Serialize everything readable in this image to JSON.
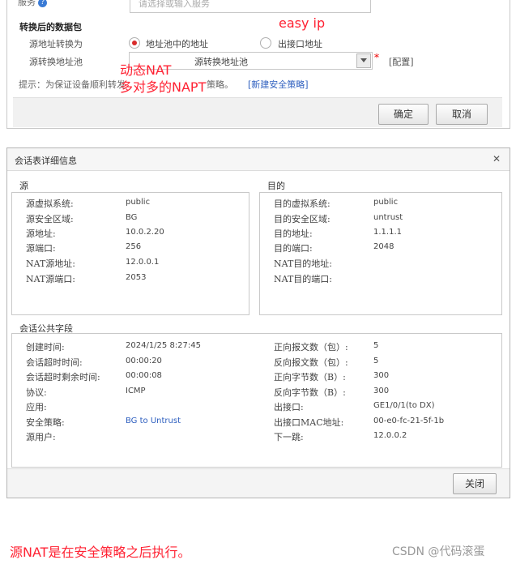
{
  "top_dialog": {
    "service_label": "服务",
    "service_placeholder": "请选择或输入服务",
    "section_title": "转换后的数据包",
    "src_translate_label": "源地址转换为",
    "radio_pool_label": "地址池中的地址",
    "radio_iface_label": "出接口地址",
    "pool_label": "源转换地址池",
    "pool_select_value": "源转换地址池",
    "pool_required_mark": "*",
    "pool_config_link": "[配置]",
    "tip_text": "提示：为保证设备顺利转发",
    "tip_text_end": "策略。",
    "tip_link": "[新建安全策略]",
    "ok_button": "确定",
    "cancel_button": "取消",
    "selected_option": "地址池中的地址"
  },
  "annotations": {
    "easy_ip": "easy ip",
    "nat_line1": "动态NAT",
    "nat_line2": "多对多的NAPT",
    "bottom_note": "源NAT是在安全策略之后执行。",
    "color": "#ff2233"
  },
  "session_dialog": {
    "title": "会话表详细信息",
    "close_button": "关闭",
    "source": {
      "heading": "源",
      "rows": [
        {
          "label": "源虚拟系统:",
          "value": "public"
        },
        {
          "label": "源安全区域:",
          "value": "BG"
        },
        {
          "label": "源地址:",
          "value": "10.0.2.20"
        },
        {
          "label": "源端口:",
          "value": "256"
        },
        {
          "label": "NAT源地址:",
          "value": "12.0.0.1"
        },
        {
          "label": "NAT源端口:",
          "value": "2053"
        }
      ]
    },
    "dest": {
      "heading": "目的",
      "rows": [
        {
          "label": "目的虚拟系统:",
          "value": "public"
        },
        {
          "label": "目的安全区域:",
          "value": "untrust"
        },
        {
          "label": "目的地址:",
          "value": "1.1.1.1"
        },
        {
          "label": "目的端口:",
          "value": "2048"
        },
        {
          "label": "NAT目的地址:",
          "value": ""
        },
        {
          "label": "NAT目的端口:",
          "value": ""
        }
      ]
    },
    "common": {
      "heading": "会话公共字段",
      "left_rows": [
        {
          "label": "创建时间:",
          "value": "2024/1/25 8:27:45"
        },
        {
          "label": "会话超时时间:",
          "value": "00:00:20"
        },
        {
          "label": "会话超时剩余时间:",
          "value": "00:00:08"
        },
        {
          "label": "协议:",
          "value": "ICMP"
        },
        {
          "label": "应用:",
          "value": ""
        },
        {
          "label": "安全策略:",
          "value": "BG  to Untrust"
        },
        {
          "label": "源用户:",
          "value": ""
        }
      ],
      "right_rows": [
        {
          "label": "正向报文数（包）:",
          "value": "5"
        },
        {
          "label": "反向报文数（包）:",
          "value": "5"
        },
        {
          "label": "正向字节数（B）:",
          "value": "300"
        },
        {
          "label": "反向字节数（B）:",
          "value": "300"
        },
        {
          "label": "出接口:",
          "value": "GE1/0/1(to DX)"
        },
        {
          "label": "出接口MAC地址:",
          "value": "00-e0-fc-21-5f-1b"
        },
        {
          "label": "下一跳:",
          "value": "12.0.0.2"
        }
      ]
    }
  },
  "watermark": "CSDN @代码滚蛋"
}
